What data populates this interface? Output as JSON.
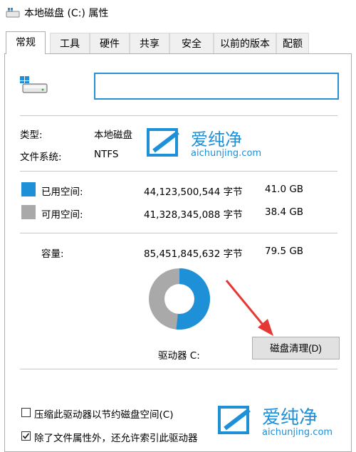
{
  "window": {
    "title": "本地磁盘 (C:) 属性"
  },
  "tabs": [
    {
      "label": "常规"
    },
    {
      "label": "工具"
    },
    {
      "label": "硬件"
    },
    {
      "label": "共享"
    },
    {
      "label": "安全"
    },
    {
      "label": "以前的版本"
    },
    {
      "label": "配额"
    }
  ],
  "general": {
    "name_value": "",
    "type_label": "类型:",
    "type_value": "本地磁盘",
    "fs_label": "文件系统:",
    "fs_value": "NTFS",
    "used_label": "已用空间:",
    "used_bytes": "44,123,500,544 字节",
    "used_gb": "41.0 GB",
    "free_label": "可用空间:",
    "free_bytes": "41,328,345,088 字节",
    "free_gb": "38.4 GB",
    "capacity_label": "容量:",
    "capacity_bytes": "85,451,845,632 字节",
    "capacity_gb": "79.5 GB",
    "drive_label": "驱动器 C:",
    "cleanup_button": "磁盘清理(D)",
    "used_fraction": 0.516,
    "compress_option": "压缩此驱动器以节约磁盘空间(C)",
    "index_option": "除了文件属性外，还允许索引此驱动器",
    "used_color": "#1e90d8",
    "free_color": "#a9a9a9"
  },
  "watermark": {
    "brand": "爱纯净",
    "site": "aichunjing.com"
  }
}
